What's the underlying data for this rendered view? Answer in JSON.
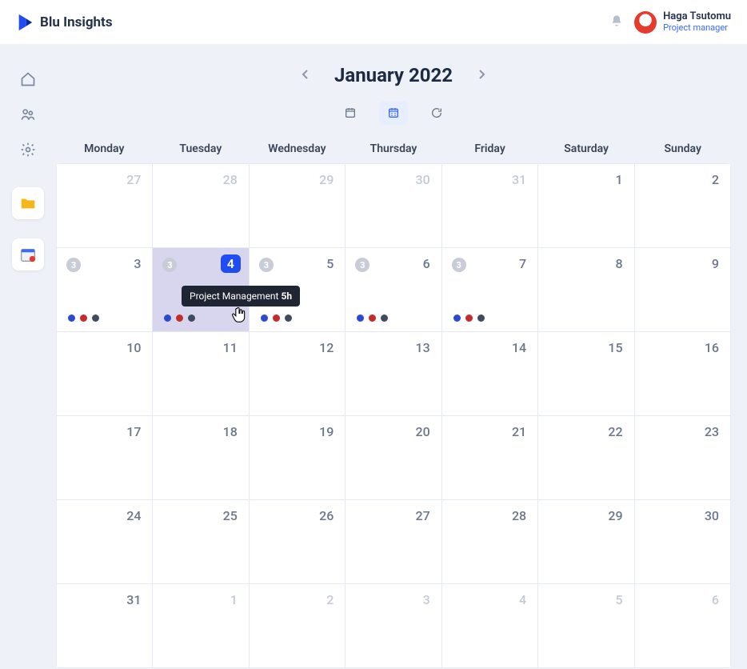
{
  "app_name": "Blu Insights",
  "user": {
    "name": "Haga Tsutomu",
    "role": "Project manager"
  },
  "calendar": {
    "title": "January 2022",
    "dow": [
      "Monday",
      "Tuesday",
      "Wednesday",
      "Thursday",
      "Friday",
      "Saturday",
      "Sunday"
    ],
    "cells": [
      {
        "n": "27",
        "dim": true
      },
      {
        "n": "28",
        "dim": true
      },
      {
        "n": "29",
        "dim": true
      },
      {
        "n": "30",
        "dim": true
      },
      {
        "n": "31",
        "dim": true
      },
      {
        "n": "1"
      },
      {
        "n": "2"
      },
      {
        "n": "3",
        "badge": "3",
        "dots": [
          "b",
          "r",
          "g"
        ]
      },
      {
        "n": "4",
        "badge": "3",
        "dots": [
          "b",
          "r",
          "g"
        ],
        "today": true,
        "selected": true
      },
      {
        "n": "5",
        "badge": "3",
        "dots": [
          "b",
          "r",
          "g"
        ]
      },
      {
        "n": "6",
        "badge": "3",
        "dots": [
          "b",
          "r",
          "g"
        ]
      },
      {
        "n": "7",
        "badge": "3",
        "dots": [
          "b",
          "r",
          "g"
        ]
      },
      {
        "n": "8"
      },
      {
        "n": "9"
      },
      {
        "n": "10"
      },
      {
        "n": "11"
      },
      {
        "n": "12"
      },
      {
        "n": "13"
      },
      {
        "n": "14"
      },
      {
        "n": "15"
      },
      {
        "n": "16"
      },
      {
        "n": "17"
      },
      {
        "n": "18"
      },
      {
        "n": "19"
      },
      {
        "n": "20"
      },
      {
        "n": "21"
      },
      {
        "n": "22"
      },
      {
        "n": "23"
      },
      {
        "n": "24"
      },
      {
        "n": "25"
      },
      {
        "n": "26"
      },
      {
        "n": "27"
      },
      {
        "n": "28"
      },
      {
        "n": "29"
      },
      {
        "n": "30"
      },
      {
        "n": "31"
      },
      {
        "n": "1",
        "dim": true
      },
      {
        "n": "2",
        "dim": true
      },
      {
        "n": "3",
        "dim": true
      },
      {
        "n": "4",
        "dim": true
      },
      {
        "n": "5",
        "dim": true
      },
      {
        "n": "6",
        "dim": true
      }
    ]
  },
  "tooltip": {
    "label": "Project Management",
    "hours": "5h"
  }
}
